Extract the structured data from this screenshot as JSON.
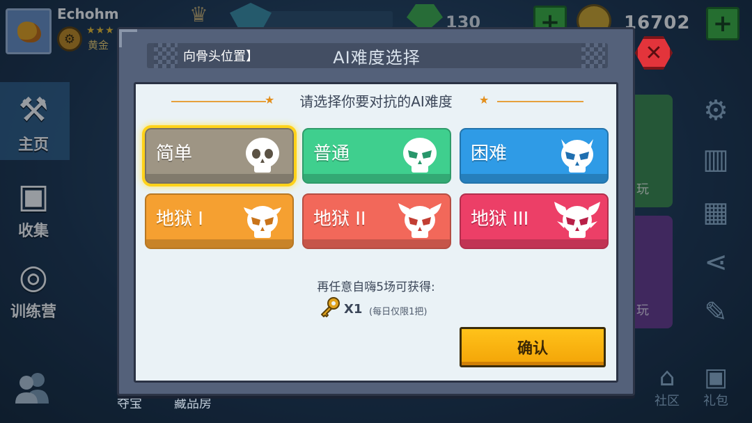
{
  "player": {
    "name": "Echohm",
    "rank_stars": "★★★",
    "rank": "黄金"
  },
  "top_bar": {
    "gems": "130",
    "coins": "16702"
  },
  "nav": {
    "home": "主页",
    "collection": "收集",
    "training": "训练营"
  },
  "background": {
    "under_dialog_left": "夺宝",
    "under_dialog_mid": "藏品房",
    "mode_card_1": "玩",
    "mode_card_2": "玩"
  },
  "bottom_right": {
    "community": "社区",
    "gift": "礼包"
  },
  "dialog": {
    "header_left": "向骨头位置】",
    "title": "AI难度选择",
    "prompt": "请选择你要对抗的AI难度",
    "difficulties": [
      {
        "label": "简单",
        "color": "#9e9584",
        "selected": true
      },
      {
        "label": "普通",
        "color": "#3fcf8e",
        "selected": false
      },
      {
        "label": "困难",
        "color": "#2f9be6",
        "selected": false
      },
      {
        "label": "地狱 I",
        "color": "#f5a031",
        "selected": false
      },
      {
        "label": "地狱 II",
        "color": "#f2685a",
        "selected": false
      },
      {
        "label": "地狱 III",
        "color": "#ec3f67",
        "selected": false
      }
    ],
    "reward_text": "再任意自嗨5场可获得:",
    "reward_count": "X1",
    "reward_limit": "(每日仅限1把)",
    "confirm": "确认"
  },
  "icons": {
    "home": "crossed-hammers-icon",
    "collection": "treasure-chest-icon",
    "training": "target-icon",
    "friends": "friends-icon",
    "settings": "gear-icon",
    "stats": "bar-chart-icon",
    "calendar": "calendar-icon",
    "share": "share-icon",
    "paint": "brush-icon",
    "community": "temple-icon",
    "gift": "gift-icon",
    "skull": "skull-icon",
    "key": "key-icon",
    "close": "close-icon"
  },
  "colors": {
    "panel": "#eaf2f6",
    "dialog": "#54617a",
    "confirm": "#ffc21a",
    "close": "#e3343b",
    "selected_glow": "#ffd21a"
  }
}
